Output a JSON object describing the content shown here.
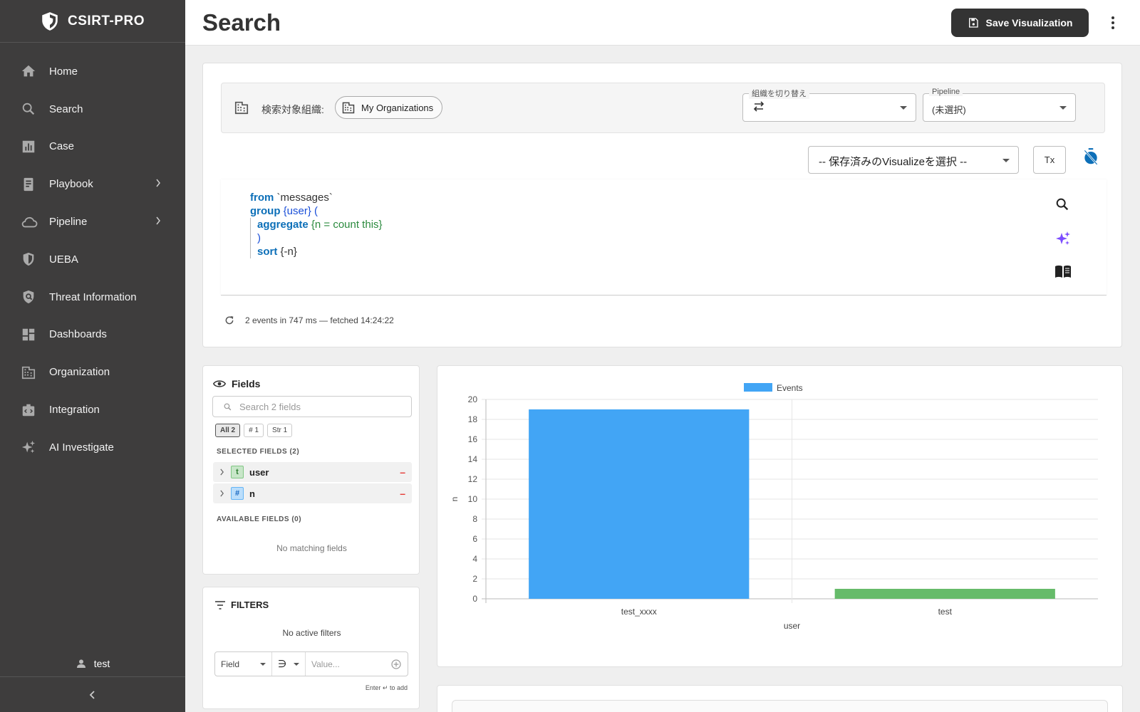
{
  "app": {
    "name": "CSIRT-PRO"
  },
  "sidebar": {
    "items": [
      {
        "label": "Home",
        "icon": "home-icon",
        "has_submenu": false
      },
      {
        "label": "Search",
        "icon": "search-icon",
        "has_submenu": false
      },
      {
        "label": "Case",
        "icon": "chart-box-icon",
        "has_submenu": false
      },
      {
        "label": "Playbook",
        "icon": "book-icon",
        "has_submenu": true
      },
      {
        "label": "Pipeline",
        "icon": "cloud-icon",
        "has_submenu": true
      },
      {
        "label": "UEBA",
        "icon": "shield-icon",
        "has_submenu": false
      },
      {
        "label": "Threat Information",
        "icon": "shield-search-icon",
        "has_submenu": false
      },
      {
        "label": "Dashboards",
        "icon": "dashboard-icon",
        "has_submenu": false
      },
      {
        "label": "Organization",
        "icon": "building-icon",
        "has_submenu": false
      },
      {
        "label": "Integration",
        "icon": "integration-icon",
        "has_submenu": false
      },
      {
        "label": "AI Investigate",
        "icon": "sparkles-icon",
        "has_submenu": false
      }
    ],
    "user": "test"
  },
  "header": {
    "title": "Search",
    "save_label": "Save Visualization"
  },
  "query": {
    "org_label": "検索対象組織:",
    "org_chip": "My Organizations",
    "org_switch_label": "組織を切り替え",
    "pipeline_label": "Pipeline",
    "pipeline_value": "(未選択)",
    "saved_viz_placeholder": "-- 保存済みのVisualizeを選択 --",
    "clear_format_label": "Tx",
    "code_lines": [
      {
        "kw": "from",
        "rest": " `messages`"
      },
      {
        "kw": "group",
        "rest": " {user} ("
      },
      {
        "kw": "aggregate",
        "rest": " {n = count this}"
      },
      {
        "kw": "",
        "rest": ")"
      },
      {
        "kw": "sort",
        "rest": " {-n}"
      }
    ],
    "status": "2 events in 747 ms — fetched 14:24:22"
  },
  "fields": {
    "title": "Fields",
    "search_placeholder": "Search 2 fields",
    "filter_chips": [
      "All 2",
      "# 1",
      "Str 1"
    ],
    "selected_header": "SELECTED FIELDS (2)",
    "selected": [
      {
        "name": "user",
        "type": "t"
      },
      {
        "name": "n",
        "type": "#"
      }
    ],
    "available_header": "AVAILABLE FIELDS (0)",
    "empty_text": "No matching fields"
  },
  "filters": {
    "title": "FILTERS",
    "empty_text": "No active filters",
    "field_placeholder": "Field",
    "operator": "∋",
    "value_placeholder": "Value...",
    "hint": "Enter ↵ to add"
  },
  "chart_data": {
    "type": "bar",
    "categories": [
      "test_xxxx",
      "test"
    ],
    "series": [
      {
        "name": "Events",
        "values": [
          19,
          1
        ]
      }
    ],
    "bar_colors": [
      "#42a5f5",
      "#66bb6a"
    ],
    "xlabel": "user",
    "ylabel": "n",
    "ylim": [
      0,
      20
    ],
    "yticks": [
      0,
      2,
      4,
      6,
      8,
      10,
      12,
      14,
      16,
      18,
      20
    ],
    "legend_position": "top",
    "grid": true
  },
  "colors": {
    "sidebar_bg": "#3e3d3d",
    "accent_blue": "#0c6fb8",
    "ai_purple": "#7c4dff"
  }
}
